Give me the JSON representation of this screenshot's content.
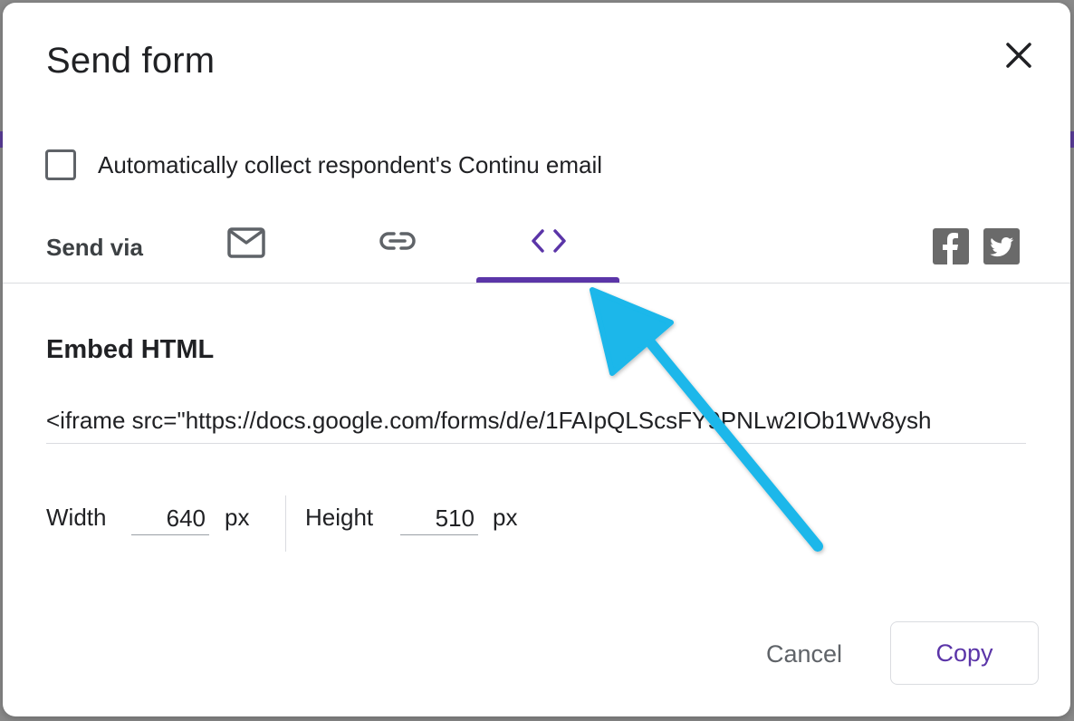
{
  "dialog": {
    "title": "Send form",
    "close_icon": "close-icon"
  },
  "options": {
    "collect_email_label": "Automatically collect respondent's Continu email",
    "collect_email_checked": false
  },
  "send_via": {
    "label": "Send via",
    "tabs": [
      {
        "icon": "email-icon",
        "active": false
      },
      {
        "icon": "link-icon",
        "active": false
      },
      {
        "icon": "embed-code-icon",
        "active": true
      }
    ],
    "social": [
      {
        "icon": "facebook-icon"
      },
      {
        "icon": "twitter-icon"
      }
    ]
  },
  "embed": {
    "title": "Embed HTML",
    "code": "<iframe src=\"https://docs.google.com/forms/d/e/1FAIpQLScsFY9PNLw2IOb1Wv8ysh",
    "width_label": "Width",
    "width_value": "640",
    "width_unit": "px",
    "height_label": "Height",
    "height_value": "510",
    "height_unit": "px"
  },
  "actions": {
    "cancel_label": "Cancel",
    "copy_label": "Copy"
  },
  "colors": {
    "accent": "#5b35a8",
    "annotation_arrow": "#1ab7ea",
    "icon_gray": "#5f6368"
  }
}
